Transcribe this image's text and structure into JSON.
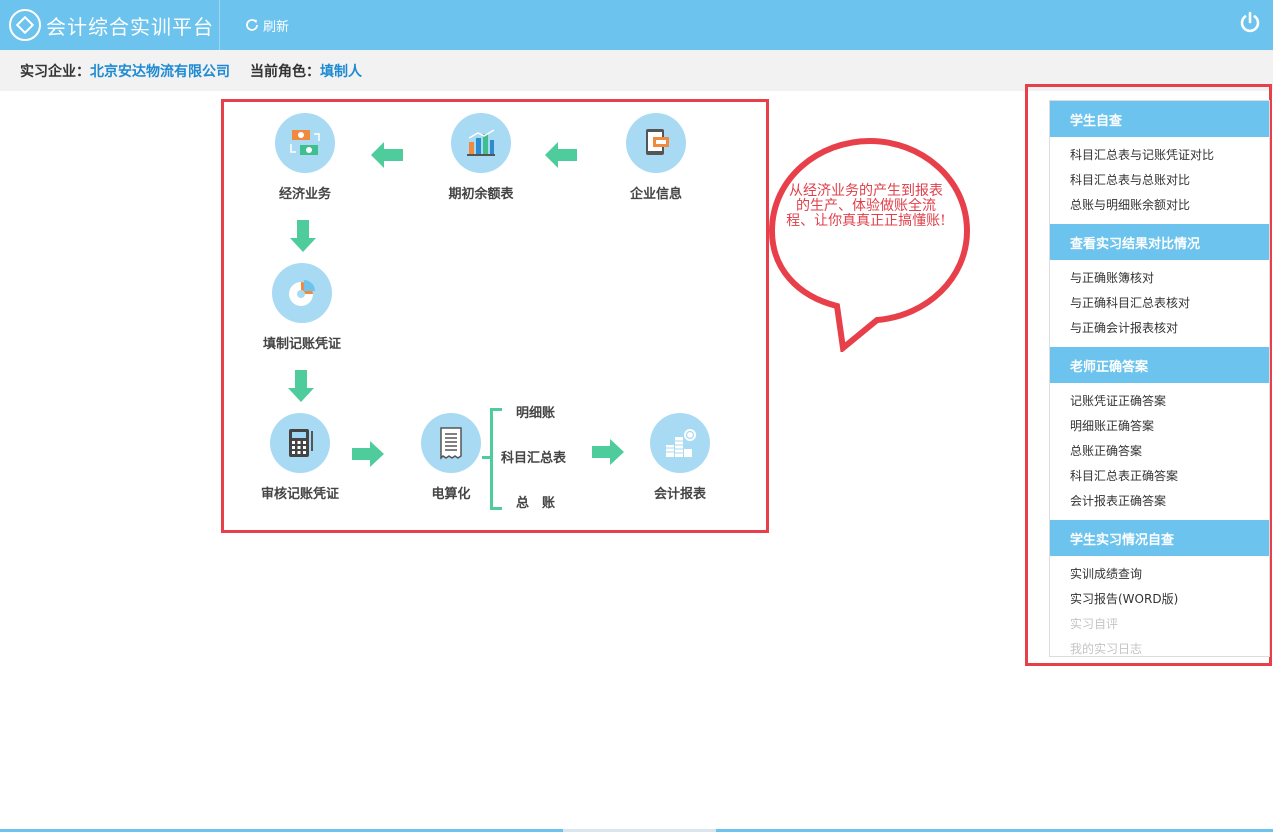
{
  "header": {
    "app_title": "会计综合实训平台",
    "refresh_label": "刷新",
    "accent_color": "#6bc3ee"
  },
  "info": {
    "company_label": "实习企业：",
    "company_value": "北京安达物流有限公司",
    "role_label": "当前角色：",
    "role_value": "填制人"
  },
  "flow": {
    "nodes": {
      "economic_business": "经济业务",
      "opening_balance": "期初余额表",
      "company_info": "企业信息",
      "fill_voucher": "填制记账凭证",
      "audit_voucher": "审核记账凭证",
      "computerization": "电算化",
      "financial_report": "会计报表"
    },
    "sub_items": {
      "detail_ledger": "明细账",
      "account_summary": "科目汇总表",
      "general_ledger": "总　账"
    },
    "arrow_color": "#4fcc9c",
    "highlight_color": "#e8404b"
  },
  "bubble": {
    "text": "从经济业务的产生到报表的生产、体验做账全流程、让你真真正正搞懂账!"
  },
  "sidebar": {
    "sections": [
      {
        "title": "学生自查",
        "items": [
          {
            "label": "科目汇总表与记账凭证对比",
            "disabled": false
          },
          {
            "label": "科目汇总表与总账对比",
            "disabled": false
          },
          {
            "label": "总账与明细账余额对比",
            "disabled": false
          }
        ]
      },
      {
        "title": "查看实习结果对比情况",
        "items": [
          {
            "label": "与正确账簿核对",
            "disabled": false
          },
          {
            "label": "与正确科目汇总表核对",
            "disabled": false
          },
          {
            "label": "与正确会计报表核对",
            "disabled": false
          }
        ]
      },
      {
        "title": "老师正确答案",
        "items": [
          {
            "label": "记账凭证正确答案",
            "disabled": false
          },
          {
            "label": "明细账正确答案",
            "disabled": false
          },
          {
            "label": "总账正确答案",
            "disabled": false
          },
          {
            "label": "科目汇总表正确答案",
            "disabled": false
          },
          {
            "label": "会计报表正确答案",
            "disabled": false
          }
        ]
      },
      {
        "title": "学生实习情况自查",
        "items": [
          {
            "label": "实训成绩查询",
            "disabled": false
          },
          {
            "label": "实习报告(WORD版)",
            "disabled": false
          },
          {
            "label": "实习自评",
            "disabled": true
          },
          {
            "label": "我的实习日志",
            "disabled": true
          }
        ]
      }
    ]
  }
}
